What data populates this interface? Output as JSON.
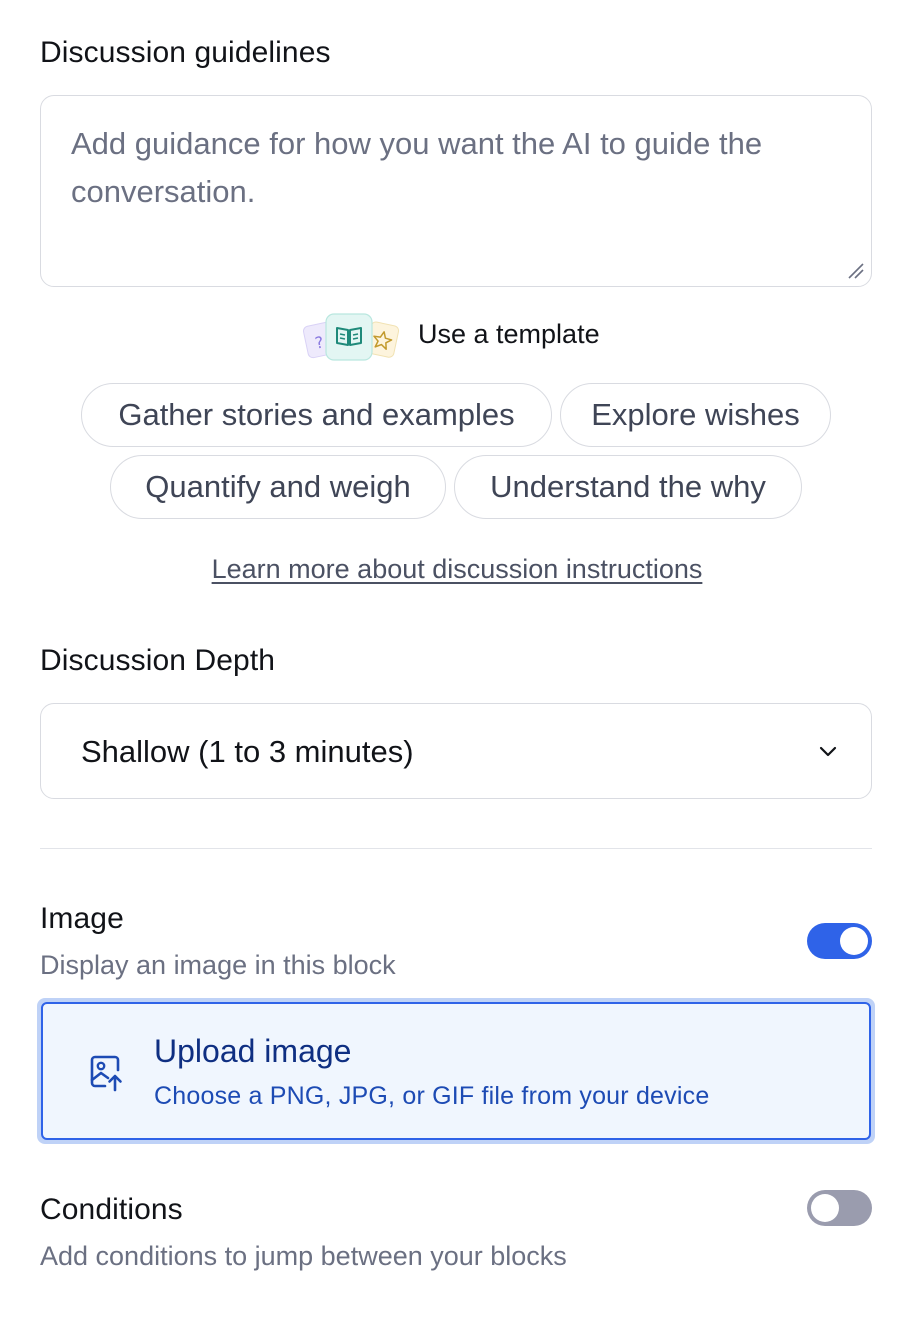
{
  "guidelines": {
    "title": "Discussion guidelines",
    "placeholder": "Add guidance for how you want the AI to guide the conversation.",
    "value": ""
  },
  "template": {
    "label": "Use a template",
    "icons": [
      "question-card-icon",
      "book-icon",
      "star-icon"
    ],
    "chips": [
      "Gather stories and examples",
      "Explore wishes",
      "Quantify and weigh",
      "Understand the why"
    ]
  },
  "learn_more": "Learn more about discussion instructions",
  "depth": {
    "title": "Discussion Depth",
    "selected": "Shallow (1 to 3 minutes)"
  },
  "image": {
    "title": "Image",
    "subtitle": "Display an image in this block",
    "enabled": true,
    "upload_title": "Upload image",
    "upload_desc": "Choose a PNG, JPG, or GIF file from your device"
  },
  "conditions": {
    "title": "Conditions",
    "subtitle": "Add conditions to jump between your blocks",
    "enabled": false
  },
  "colors": {
    "accent": "#2f63e8",
    "toggle_off": "#9a9cae",
    "upload_bg": "#f0f6fe",
    "upload_text": "#0f2f82"
  }
}
